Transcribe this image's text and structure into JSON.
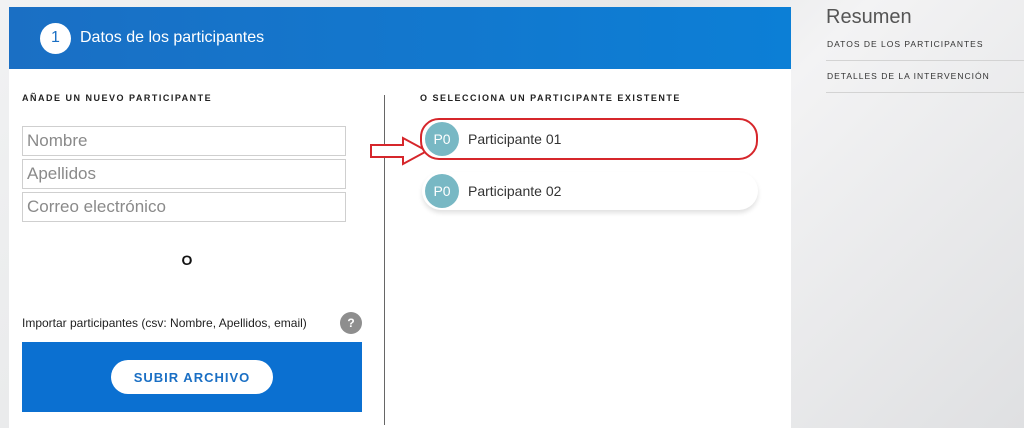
{
  "step": {
    "number": "1",
    "title": "Datos de los participantes"
  },
  "left": {
    "section_title": "AÑADE UN NUEVO PARTICIPANTE",
    "fields": {
      "first_name_placeholder": "Nombre",
      "last_name_placeholder": "Apellidos",
      "email_placeholder": "Correo electrónico"
    },
    "or_label": "O",
    "import_label": "Importar participantes (csv: Nombre, Apellidos, email)",
    "help_icon": "?",
    "upload_button": "SUBIR ARCHIVO"
  },
  "right": {
    "section_title": "O SELECCIONA UN PARTICIPANTE EXISTENTE",
    "participants": [
      {
        "initials": "P0",
        "name": "Participante 01"
      },
      {
        "initials": "P0",
        "name": "Participante 02"
      }
    ]
  },
  "summary": {
    "title": "Resumen",
    "items": [
      "DATOS DE LOS PARTICIPANTES",
      "DETALLES DE LA INTERVENCIÓN"
    ]
  },
  "colors": {
    "primary": "#0b70d1",
    "highlight": "#d6262b",
    "avatar": "#78b8c4"
  }
}
